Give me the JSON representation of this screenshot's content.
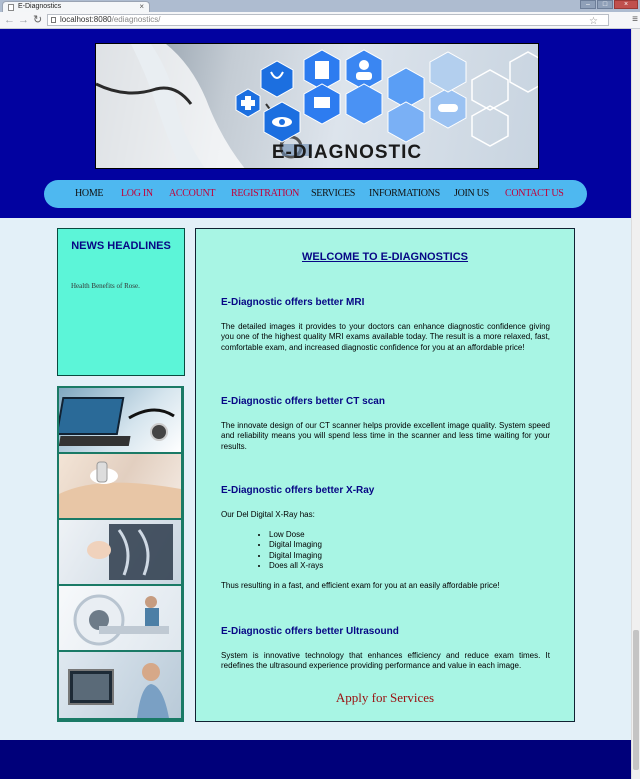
{
  "browser": {
    "tab_title": "E-Diagnostics",
    "tab_close": "×",
    "url_host": "localhost:8080",
    "url_path": "/ediagnostics/",
    "back_glyph": "←",
    "forward_glyph": "→",
    "reload_glyph": "↻",
    "star_glyph": "☆",
    "menu_glyph": "≡",
    "window_buttons": [
      "–",
      "□",
      "×"
    ]
  },
  "banner": {
    "title": "E-DIAGNOSTIC",
    "icons": [
      "medical-cross-icon",
      "clipboard-icon",
      "doctor-icon",
      "eye-icon",
      "monitor-icon",
      "pill-icon",
      "stethoscope-icon"
    ]
  },
  "nav": {
    "items": [
      "HOME",
      "LOG IN",
      "ACCOUNT",
      "REGISTRATION",
      "SERVICES",
      "INFORMATIONS",
      "JOIN US",
      "CONTACT US"
    ],
    "colors": {
      "black": "#111111",
      "red": "#c2003a"
    }
  },
  "news": {
    "title": "NEWS HEADLINES",
    "items": [
      "Health Benefits of Rose."
    ]
  },
  "side_images": [
    "laptop-stethoscope-photo",
    "ultrasound-photo",
    "xray-photo",
    "ct-scanner-photo",
    "ultrasound-monitor-photo"
  ],
  "main": {
    "welcome": "WELCOME TO E-DIAGNOSTICS",
    "sections": [
      {
        "heading": "E-Diagnostic offers better MRI",
        "text": "The detailed images it provides to your doctors can enhance diagnostic confidence giving you one of the highest quality MRI exams available today. The result is a more relaxed, fast, comfortable exam, and increased diagnostic confidence for you at an affordable price!"
      },
      {
        "heading": "E-Diagnostic offers better CT scan",
        "text": "The innovate design of our CT scanner helps provide excellent image quality. System speed and reliability means you will spend less time in the scanner and less time waiting for your results."
      },
      {
        "heading": "E-Diagnostic offers better X-Ray",
        "text": "Our Del Digital X-Ray has:",
        "bullets": [
          "Low Dose",
          "Digital Imaging",
          "Digital Imaging",
          "Does all X-rays"
        ],
        "after": "Thus resulting in a fast, and efficient exam for you at an easily affordable price!"
      },
      {
        "heading": "E-Diagnostic offers better Ultrasound",
        "text": "System is innovative technology that enhances efficiency and reduce exam times. It redefines the ultrasound experience providing performance and value in each image."
      }
    ],
    "apply": "Apply for Services"
  },
  "colors": {
    "header_bg": "#0202a0",
    "nav_bg": "#4eb8f0",
    "news_bg": "#5cf5d8",
    "main_bg": "#a8f5e4",
    "heading": "#070785",
    "footer_bg": "#00007a"
  }
}
